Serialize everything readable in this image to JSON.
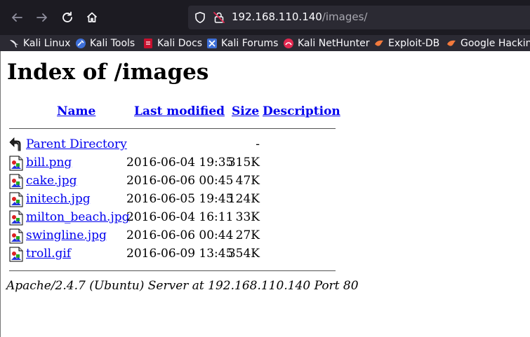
{
  "browser": {
    "url_host": "192.168.110.140",
    "url_path": "/images/",
    "bookmarks": [
      {
        "label": "Kali Linux",
        "icon": "kali-dragon-icon"
      },
      {
        "label": "Kali Tools",
        "icon": "kali-tools-icon"
      },
      {
        "label": "Kali Docs",
        "icon": "kali-docs-icon"
      },
      {
        "label": "Kali Forums",
        "icon": "kali-forums-icon"
      },
      {
        "label": "Kali NetHunter",
        "icon": "kali-nethunter-icon"
      },
      {
        "label": "Exploit-DB",
        "icon": "exploit-db-icon"
      },
      {
        "label": "Google Hacking",
        "icon": "google-hacking-icon"
      }
    ]
  },
  "page": {
    "title": "Index of /images",
    "columns": {
      "name": "Name",
      "last_modified": "Last modified",
      "size": "Size",
      "description": "Description"
    },
    "parent": {
      "name": "Parent Directory",
      "size": "-"
    },
    "files": [
      {
        "name": "bill.png",
        "modified": "2016-06-04 19:35",
        "size": "315K"
      },
      {
        "name": "cake.jpg",
        "modified": "2016-06-06 00:45",
        "size": "47K"
      },
      {
        "name": "initech.jpg",
        "modified": "2016-06-05 19:45",
        "size": "124K"
      },
      {
        "name": "milton_beach.jpg",
        "modified": "2016-06-04 16:11",
        "size": "33K"
      },
      {
        "name": "swingline.jpg",
        "modified": "2016-06-06 00:44",
        "size": "27K"
      },
      {
        "name": "troll.gif",
        "modified": "2016-06-09 13:45",
        "size": "354K"
      }
    ],
    "address": "Apache/2.4.7 (Ubuntu) Server at 192.168.110.140 Port 80"
  }
}
